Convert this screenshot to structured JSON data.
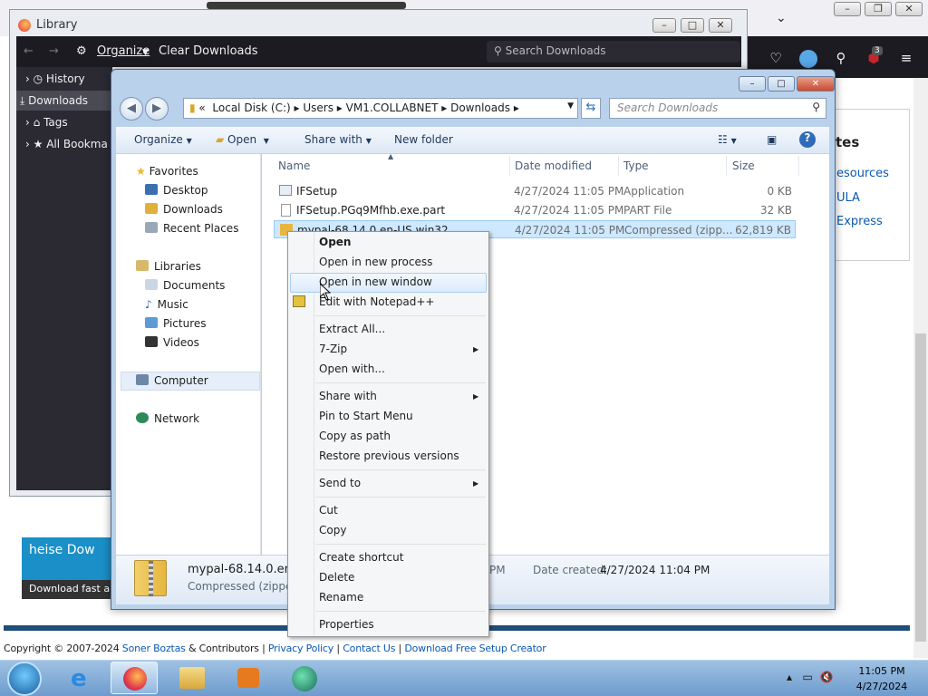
{
  "browser": {
    "toolbar_icons": [
      "pocket-icon",
      "account-icon",
      "extensions-icon",
      "ublock-icon",
      "hamburger-menu-icon"
    ],
    "ublock_badge": "3",
    "page_heading_fragment": "tes",
    "page_links": [
      "esources",
      "ULA",
      "Express"
    ],
    "banner_text": "heise Dow",
    "banner_subtext": "Download fast and",
    "footer": {
      "copyright_prefix": "Copyright © 2007-2024 ",
      "author": "Soner Boztas",
      "contributors": " & Contributors | ",
      "privacy": "Privacy Policy",
      "sep1": " | ",
      "contact": "Contact Us",
      "sep2": " | ",
      "download": "Download Free Setup Creator"
    }
  },
  "library": {
    "title": "Library",
    "organize": "Organize",
    "clear": "Clear Downloads",
    "search_placeholder": "Search Downloads",
    "sidebar": [
      {
        "label": "History",
        "icon": "clock-icon"
      },
      {
        "label": "Downloads",
        "icon": "download-icon"
      },
      {
        "label": "Tags",
        "icon": "tag-icon"
      },
      {
        "label": "All Bookma",
        "icon": "star-icon"
      }
    ]
  },
  "explorer": {
    "address": {
      "prefix": "«",
      "crumbs": [
        "Local Disk (C:)",
        "Users",
        "VM1.COLLABNET",
        "Downloads"
      ]
    },
    "search_placeholder": "Search Downloads",
    "commands": {
      "organize": "Organize",
      "open": "Open",
      "share": "Share with",
      "new_folder": "New folder"
    },
    "nav": {
      "favorites": "Favorites",
      "desktop": "Desktop",
      "downloads": "Downloads",
      "recent": "Recent Places",
      "libraries": "Libraries",
      "documents": "Documents",
      "music": "Music",
      "pictures": "Pictures",
      "videos": "Videos",
      "computer": "Computer",
      "network": "Network"
    },
    "columns": {
      "name": "Name",
      "date": "Date modified",
      "type": "Type",
      "size": "Size"
    },
    "files": [
      {
        "name": "IFSetup",
        "date": "4/27/2024 11:05 PM",
        "type": "Application",
        "size": "0 KB"
      },
      {
        "name": "IFSetup.PGq9Mfhb.exe.part",
        "date": "4/27/2024 11:05 PM",
        "type": "PART File",
        "size": "32 KB"
      },
      {
        "name": "mypal-68.14.0.en-US.win32",
        "date": "4/27/2024 11:05 PM",
        "type": "Compressed (zipp...",
        "size": "62,819 KB"
      }
    ],
    "details": {
      "name": "mypal-68.14.0.en-U",
      "type": "Compressed (zipped)",
      "time_fragment": "PM",
      "date_created_label": "Date created:",
      "date_created": "4/27/2024 11:04 PM"
    }
  },
  "context_menu": {
    "open": "Open",
    "open_process": "Open in new process",
    "open_window": "Open in new window",
    "notepad": "Edit with Notepad++",
    "extract": "Extract All...",
    "zip": "7-Zip",
    "open_with": "Open with...",
    "share": "Share with",
    "pin": "Pin to Start Menu",
    "copy_path": "Copy as path",
    "restore": "Restore previous versions",
    "send_to": "Send to",
    "cut": "Cut",
    "copy": "Copy",
    "shortcut": "Create shortcut",
    "delete": "Delete",
    "rename": "Rename",
    "properties": "Properties"
  },
  "taskbar": {
    "time": "11:05 PM",
    "date": "4/27/2024"
  }
}
